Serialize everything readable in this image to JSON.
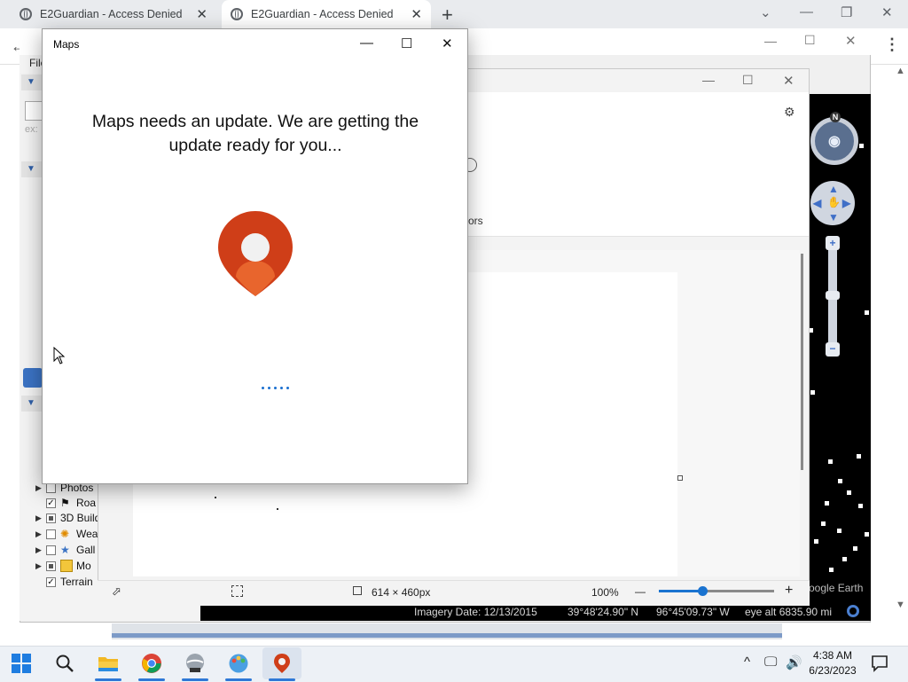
{
  "browser": {
    "tabs": [
      {
        "title": "E2Guardian - Access Denied",
        "active": false
      },
      {
        "title": "E2Guardian - Access Denied",
        "active": true
      }
    ],
    "new_tab": "+",
    "window_controls": {
      "minimize": "—",
      "restore": "❐",
      "close": "✕",
      "dropdown": "⌄"
    },
    "menu": "⋮",
    "back": "←"
  },
  "google_earth": {
    "menu_first": "File",
    "search_hint": "ex:",
    "layers": [
      {
        "label": "Photos",
        "checked": false,
        "icon": "photo-icon"
      },
      {
        "label": "Roa",
        "checked": true,
        "icon": "road-icon"
      },
      {
        "label": "3D Build",
        "checked": "partial",
        "icon": "building-icon"
      },
      {
        "label": "Wea",
        "checked": false,
        "icon": "weather-icon"
      },
      {
        "label": "Gall",
        "checked": false,
        "icon": "gallery-icon"
      },
      {
        "label": "Mo",
        "checked": "partial",
        "icon": "more-icon"
      },
      {
        "label": "Terrain",
        "checked": true,
        "icon": ""
      }
    ],
    "status": {
      "imagery_date": "Imagery Date: 12/13/2015",
      "lat": "39°48'24.90\" N",
      "lon": "96°45'09.73\" W",
      "eye_alt": "eye alt 6835.90 mi"
    },
    "watermark": "oogle Earth",
    "compass_north": "N"
  },
  "viewer": {
    "ribbon_partial_label": "ors",
    "dimensions": "614 × 460px",
    "zoom": "100%",
    "zoom_minus": "—",
    "zoom_plus": "+",
    "zoom_level": 0.38
  },
  "maps": {
    "title": "Maps",
    "message": "Maps needs an update. We are getting the update ready for you...",
    "controls": {
      "minimize": "—",
      "maximize": "☐",
      "close": "✕"
    },
    "brand_color": "#d9421c"
  },
  "taskbar": {
    "time": "4:38 AM",
    "date": "6/23/2023",
    "tray_caret": "^",
    "accent": "#2e78d6"
  }
}
